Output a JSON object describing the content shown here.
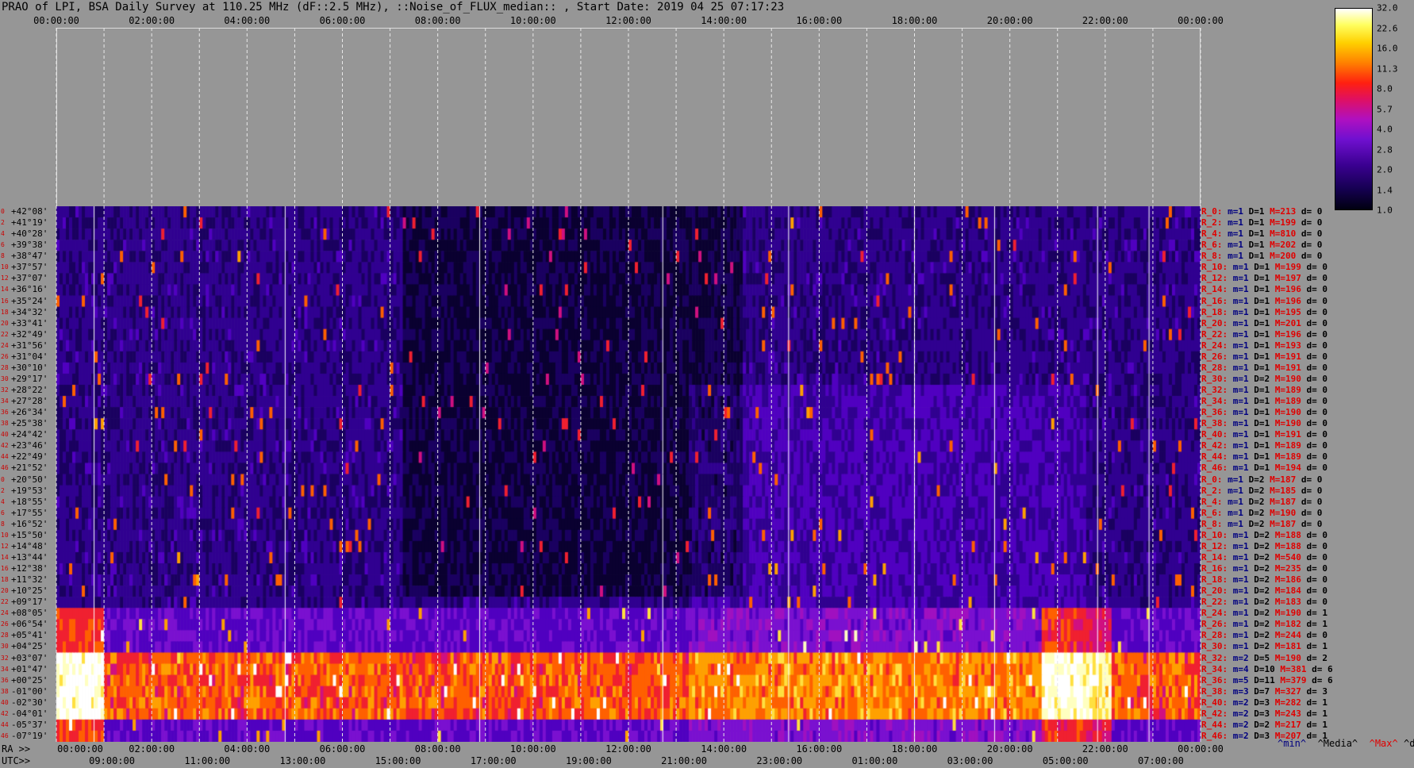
{
  "title": "PRAO of LPI, BSA Daily Survey at 110.25 MHz (dF::2.5 MHz), ::Noise_of_FLUX_median:: , Start Date: 2019 04 25 07:17:23",
  "ra_prefix": "RA >>",
  "utc_prefix": "UTC>>",
  "colorbar_ticks": [
    "32.0",
    "22.6",
    "16.0",
    "11.3",
    "8.0",
    "5.7",
    "4.0",
    "2.8",
    "2.0",
    "1.4",
    "1.0"
  ],
  "stats_legend": {
    "min": "^min^",
    "median": "^Media^",
    "max": "^Max^",
    "dev": "^devia^"
  },
  "chart_data": {
    "type": "heatmap",
    "title": "PRAO of LPI, BSA Daily Survey at 110.25 MHz (dF::2.5 MHz), ::Noise_of_FLUX_median:: , Start Date: 2019 04 25 07:17:23",
    "x_top_ticks": [
      "00:00:00",
      "02:00:00",
      "04:00:00",
      "06:00:00",
      "08:00:00",
      "10:00:00",
      "12:00:00",
      "14:00:00",
      "16:00:00",
      "18:00:00",
      "20:00:00",
      "22:00:00",
      "00:00:00"
    ],
    "x_ra_ticks": [
      "00:00:00",
      "02:00:00",
      "04:00:00",
      "06:00:00",
      "08:00:00",
      "10:00:00",
      "12:00:00",
      "14:00:00",
      "16:00:00",
      "18:00:00",
      "20:00:00",
      "22:00:00",
      "00:00:00"
    ],
    "x_utc_ticks": [
      "09:00:00",
      "11:00:00",
      "13:00:00",
      "15:00:00",
      "17:00:00",
      "19:00:00",
      "21:00:00",
      "23:00:00",
      "01:00:00",
      "03:00:00",
      "05:00:00",
      "07:00:00",
      "09:00:00"
    ],
    "colorbar": {
      "min": 1.0,
      "max": 32.0,
      "scale": "log"
    },
    "declinations": [
      "+42°08'",
      "+41°19'",
      "+40°28'",
      "+39°38'",
      "+38°47'",
      "+37°57'",
      "+37°07'",
      "+36°16'",
      "+35°24'",
      "+34°32'",
      "+33°41'",
      "+32°49'",
      "+31°56'",
      "+31°04'",
      "+30°10'",
      "+29°17'",
      "+28°22'",
      "+27°28'",
      "+26°34'",
      "+25°38'",
      "+24°42'",
      "+23°46'",
      "+22°49'",
      "+21°52'",
      "+20°50'",
      "+19°53'",
      "+18°55'",
      "+17°55'",
      "+16°52'",
      "+15°50'",
      "+14°48'",
      "+13°44'",
      "+12°38'",
      "+11°32'",
      "+10°25'",
      "+09°17'",
      "+08°05'",
      "+06°54'",
      "+05°41'",
      "+04°25'",
      "+03°07'",
      "+01°47'",
      "+00°25'",
      "-01°00'",
      "-02°30'",
      "-04°01'",
      "-05°37'",
      "-07°19'"
    ],
    "row_indices": [
      "0",
      "2",
      "4",
      "6",
      "8",
      "10",
      "12",
      "14",
      "16",
      "18",
      "20",
      "22",
      "24",
      "26",
      "28",
      "30",
      "32",
      "34",
      "36",
      "38",
      "40",
      "42",
      "44",
      "46",
      "0",
      "2",
      "4",
      "6",
      "8",
      "10",
      "12",
      "14",
      "16",
      "18",
      "20",
      "22",
      "24",
      "26",
      "28",
      "30",
      "32",
      "34",
      "36",
      "38",
      "40",
      "42",
      "44",
      "46"
    ],
    "row_stats": [
      {
        "name": "R_0:",
        "min": "m=1",
        "med": "D=1",
        "max": "M=213",
        "dev": "d= 0"
      },
      {
        "name": "R_2:",
        "min": "m=1",
        "med": "D=1",
        "max": "M=199",
        "dev": "d= 0"
      },
      {
        "name": "R_4:",
        "min": "m=1",
        "med": "D=1",
        "max": "M=810",
        "dev": "d= 0"
      },
      {
        "name": "R_6:",
        "min": "m=1",
        "med": "D=1",
        "max": "M=202",
        "dev": "d= 0"
      },
      {
        "name": "R_8:",
        "min": "m=1",
        "med": "D=1",
        "max": "M=200",
        "dev": "d= 0"
      },
      {
        "name": "R_10:",
        "min": "m=1",
        "med": "D=1",
        "max": "M=199",
        "dev": "d= 0"
      },
      {
        "name": "R_12:",
        "min": "m=1",
        "med": "D=1",
        "max": "M=197",
        "dev": "d= 0"
      },
      {
        "name": "R_14:",
        "min": "m=1",
        "med": "D=1",
        "max": "M=196",
        "dev": "d= 0"
      },
      {
        "name": "R_16:",
        "min": "m=1",
        "med": "D=1",
        "max": "M=196",
        "dev": "d= 0"
      },
      {
        "name": "R_18:",
        "min": "m=1",
        "med": "D=1",
        "max": "M=195",
        "dev": "d= 0"
      },
      {
        "name": "R_20:",
        "min": "m=1",
        "med": "D=1",
        "max": "M=201",
        "dev": "d= 0"
      },
      {
        "name": "R_22:",
        "min": "m=1",
        "med": "D=1",
        "max": "M=196",
        "dev": "d= 0"
      },
      {
        "name": "R_24:",
        "min": "m=1",
        "med": "D=1",
        "max": "M=193",
        "dev": "d= 0"
      },
      {
        "name": "R_26:",
        "min": "m=1",
        "med": "D=1",
        "max": "M=191",
        "dev": "d= 0"
      },
      {
        "name": "R_28:",
        "min": "m=1",
        "med": "D=1",
        "max": "M=191",
        "dev": "d= 0"
      },
      {
        "name": "R_30:",
        "min": "m=1",
        "med": "D=2",
        "max": "M=190",
        "dev": "d= 0"
      },
      {
        "name": "R_32:",
        "min": "m=1",
        "med": "D=1",
        "max": "M=189",
        "dev": "d= 0"
      },
      {
        "name": "R_34:",
        "min": "m=1",
        "med": "D=1",
        "max": "M=189",
        "dev": "d= 0"
      },
      {
        "name": "R_36:",
        "min": "m=1",
        "med": "D=1",
        "max": "M=190",
        "dev": "d= 0"
      },
      {
        "name": "R_38:",
        "min": "m=1",
        "med": "D=1",
        "max": "M=190",
        "dev": "d= 0"
      },
      {
        "name": "R_40:",
        "min": "m=1",
        "med": "D=1",
        "max": "M=191",
        "dev": "d= 0"
      },
      {
        "name": "R_42:",
        "min": "m=1",
        "med": "D=1",
        "max": "M=189",
        "dev": "d= 0"
      },
      {
        "name": "R_44:",
        "min": "m=1",
        "med": "D=1",
        "max": "M=189",
        "dev": "d= 0"
      },
      {
        "name": "R_46:",
        "min": "m=1",
        "med": "D=1",
        "max": "M=194",
        "dev": "d= 0"
      },
      {
        "name": "R_0:",
        "min": "m=1",
        "med": "D=2",
        "max": "M=187",
        "dev": "d= 0"
      },
      {
        "name": "R_2:",
        "min": "m=1",
        "med": "D=2",
        "max": "M=185",
        "dev": "d= 0"
      },
      {
        "name": "R_4:",
        "min": "m=1",
        "med": "D=2",
        "max": "M=187",
        "dev": "d= 0"
      },
      {
        "name": "R_6:",
        "min": "m=1",
        "med": "D=2",
        "max": "M=190",
        "dev": "d= 0"
      },
      {
        "name": "R_8:",
        "min": "m=1",
        "med": "D=2",
        "max": "M=187",
        "dev": "d= 0"
      },
      {
        "name": "R_10:",
        "min": "m=1",
        "med": "D=2",
        "max": "M=188",
        "dev": "d= 0"
      },
      {
        "name": "R_12:",
        "min": "m=1",
        "med": "D=2",
        "max": "M=188",
        "dev": "d= 0"
      },
      {
        "name": "R_14:",
        "min": "m=1",
        "med": "D=2",
        "max": "M=540",
        "dev": "d= 0"
      },
      {
        "name": "R_16:",
        "min": "m=1",
        "med": "D=2",
        "max": "M=235",
        "dev": "d= 0"
      },
      {
        "name": "R_18:",
        "min": "m=1",
        "med": "D=2",
        "max": "M=186",
        "dev": "d= 0"
      },
      {
        "name": "R_20:",
        "min": "m=1",
        "med": "D=2",
        "max": "M=184",
        "dev": "d= 0"
      },
      {
        "name": "R_22:",
        "min": "m=1",
        "med": "D=2",
        "max": "M=183",
        "dev": "d= 0"
      },
      {
        "name": "R_24:",
        "min": "m=1",
        "med": "D=2",
        "max": "M=190",
        "dev": "d= 1"
      },
      {
        "name": "R_26:",
        "min": "m=1",
        "med": "D=2",
        "max": "M=182",
        "dev": "d= 1"
      },
      {
        "name": "R_28:",
        "min": "m=1",
        "med": "D=2",
        "max": "M=244",
        "dev": "d= 0"
      },
      {
        "name": "R_30:",
        "min": "m=1",
        "med": "D=2",
        "max": "M=181",
        "dev": "d= 1"
      },
      {
        "name": "R_32:",
        "min": "m=2",
        "med": "D=5",
        "max": "M=190",
        "dev": "d= 2"
      },
      {
        "name": "R_34:",
        "min": "m=4",
        "med": "D=10",
        "max": "M=381",
        "dev": "d= 6"
      },
      {
        "name": "R_36:",
        "min": "m=5",
        "med": "D=11",
        "max": "M=379",
        "dev": "d= 6"
      },
      {
        "name": "R_38:",
        "min": "m=3",
        "med": "D=7",
        "max": "M=327",
        "dev": "d= 3"
      },
      {
        "name": "R_40:",
        "min": "m=2",
        "med": "D=3",
        "max": "M=282",
        "dev": "d= 1"
      },
      {
        "name": "R_42:",
        "min": "m=2",
        "med": "D=3",
        "max": "M=243",
        "dev": "d= 1"
      },
      {
        "name": "R_44:",
        "min": "m=2",
        "med": "D=2",
        "max": "M=217",
        "dev": "d= 1"
      },
      {
        "name": "R_46:",
        "min": "m=2",
        "med": "D=3",
        "max": "M=207",
        "dev": "d= 1"
      }
    ]
  }
}
